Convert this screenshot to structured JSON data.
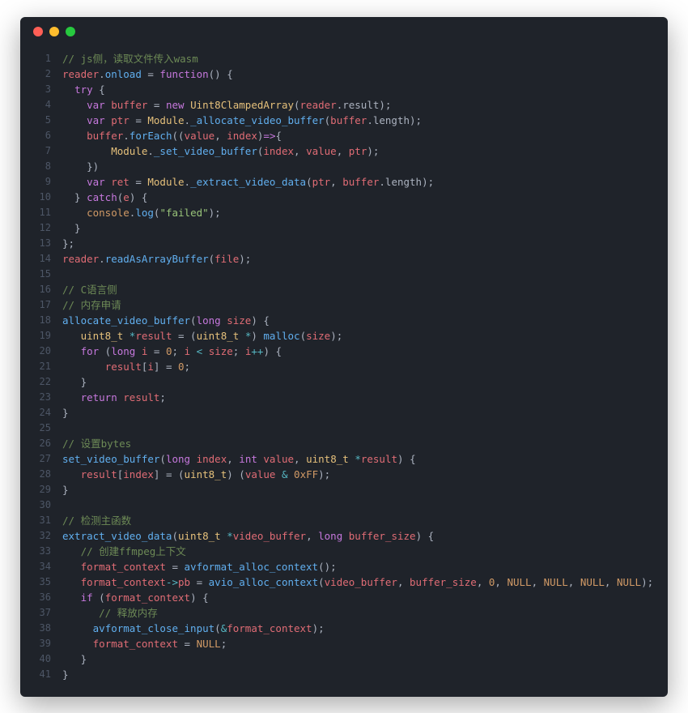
{
  "code_lines": [
    [
      [
        "cm",
        "// "
      ],
      [
        "cm-cn",
        "js侧，读取文件传入wasm"
      ]
    ],
    [
      [
        "id",
        "reader"
      ],
      [
        "punc",
        "."
      ],
      [
        "fn",
        "onload"
      ],
      [
        "punc",
        " = "
      ],
      [
        "kw",
        "function"
      ],
      [
        "punc",
        "() {"
      ]
    ],
    [
      [
        "punc",
        "  "
      ],
      [
        "kw",
        "try"
      ],
      [
        "punc",
        " {"
      ]
    ],
    [
      [
        "punc",
        "    "
      ],
      [
        "kw",
        "var"
      ],
      [
        "punc",
        " "
      ],
      [
        "id",
        "buffer"
      ],
      [
        "punc",
        " = "
      ],
      [
        "kw",
        "new"
      ],
      [
        "punc",
        " "
      ],
      [
        "type",
        "Uint8ClampedArray"
      ],
      [
        "punc",
        "("
      ],
      [
        "id",
        "reader"
      ],
      [
        "punc",
        "."
      ],
      [
        "prop",
        "result"
      ],
      [
        "punc",
        ");"
      ]
    ],
    [
      [
        "punc",
        "    "
      ],
      [
        "kw",
        "var"
      ],
      [
        "punc",
        " "
      ],
      [
        "id",
        "ptr"
      ],
      [
        "punc",
        " = "
      ],
      [
        "type",
        "Module"
      ],
      [
        "punc",
        "."
      ],
      [
        "fn",
        "_allocate_video_buffer"
      ],
      [
        "punc",
        "("
      ],
      [
        "id",
        "buffer"
      ],
      [
        "punc",
        "."
      ],
      [
        "prop",
        "length"
      ],
      [
        "punc",
        ");"
      ]
    ],
    [
      [
        "punc",
        "    "
      ],
      [
        "id",
        "buffer"
      ],
      [
        "punc",
        "."
      ],
      [
        "fn",
        "forEach"
      ],
      [
        "punc",
        "(("
      ],
      [
        "param",
        "value"
      ],
      [
        "punc",
        ", "
      ],
      [
        "param",
        "index"
      ],
      [
        "punc",
        ")"
      ],
      [
        "kw",
        "=>"
      ],
      [
        "punc",
        "{"
      ]
    ],
    [
      [
        "punc",
        "        "
      ],
      [
        "type",
        "Module"
      ],
      [
        "punc",
        "."
      ],
      [
        "fn",
        "_set_video_buffer"
      ],
      [
        "punc",
        "("
      ],
      [
        "id",
        "index"
      ],
      [
        "punc",
        ", "
      ],
      [
        "id",
        "value"
      ],
      [
        "punc",
        ", "
      ],
      [
        "id",
        "ptr"
      ],
      [
        "punc",
        ");"
      ]
    ],
    [
      [
        "punc",
        "    })"
      ]
    ],
    [
      [
        "punc",
        "    "
      ],
      [
        "kw",
        "var"
      ],
      [
        "punc",
        " "
      ],
      [
        "id",
        "ret"
      ],
      [
        "punc",
        " = "
      ],
      [
        "type",
        "Module"
      ],
      [
        "punc",
        "."
      ],
      [
        "fn",
        "_extract_video_data"
      ],
      [
        "punc",
        "("
      ],
      [
        "id",
        "ptr"
      ],
      [
        "punc",
        ", "
      ],
      [
        "id",
        "buffer"
      ],
      [
        "punc",
        "."
      ],
      [
        "prop",
        "length"
      ],
      [
        "punc",
        ");"
      ]
    ],
    [
      [
        "punc",
        "  } "
      ],
      [
        "kw",
        "catch"
      ],
      [
        "punc",
        "("
      ],
      [
        "id",
        "e"
      ],
      [
        "punc",
        ") {"
      ]
    ],
    [
      [
        "punc",
        "    "
      ],
      [
        "id2",
        "console"
      ],
      [
        "punc",
        "."
      ],
      [
        "fn",
        "log"
      ],
      [
        "punc",
        "("
      ],
      [
        "str",
        "\"failed\""
      ],
      [
        "punc",
        ");"
      ]
    ],
    [
      [
        "punc",
        "  }"
      ]
    ],
    [
      [
        "punc",
        "};"
      ]
    ],
    [
      [
        "id",
        "reader"
      ],
      [
        "punc",
        "."
      ],
      [
        "fn",
        "readAsArrayBuffer"
      ],
      [
        "punc",
        "("
      ],
      [
        "id",
        "file"
      ],
      [
        "punc",
        ");"
      ]
    ],
    [],
    [
      [
        "cm",
        "// "
      ],
      [
        "cm-cn",
        "C语言侧"
      ]
    ],
    [
      [
        "cm",
        "// "
      ],
      [
        "cm-cn",
        "内存申请"
      ]
    ],
    [
      [
        "fn",
        "allocate_video_buffer"
      ],
      [
        "punc",
        "("
      ],
      [
        "kw",
        "long"
      ],
      [
        "punc",
        " "
      ],
      [
        "param",
        "size"
      ],
      [
        "punc",
        ") {"
      ]
    ],
    [
      [
        "punc",
        "   "
      ],
      [
        "type",
        "uint8_t"
      ],
      [
        "punc",
        " "
      ],
      [
        "op",
        "*"
      ],
      [
        "id",
        "result"
      ],
      [
        "punc",
        " = ("
      ],
      [
        "type",
        "uint8_t"
      ],
      [
        "punc",
        " "
      ],
      [
        "op",
        "*"
      ],
      [
        "punc",
        ") "
      ],
      [
        "fn",
        "malloc"
      ],
      [
        "punc",
        "("
      ],
      [
        "id",
        "size"
      ],
      [
        "punc",
        ");"
      ]
    ],
    [
      [
        "punc",
        "   "
      ],
      [
        "kw",
        "for"
      ],
      [
        "punc",
        " ("
      ],
      [
        "kw",
        "long"
      ],
      [
        "punc",
        " "
      ],
      [
        "id",
        "i"
      ],
      [
        "punc",
        " = "
      ],
      [
        "num",
        "0"
      ],
      [
        "punc",
        "; "
      ],
      [
        "id",
        "i"
      ],
      [
        "punc",
        " "
      ],
      [
        "op",
        "<"
      ],
      [
        "punc",
        " "
      ],
      [
        "id",
        "size"
      ],
      [
        "punc",
        "; "
      ],
      [
        "id",
        "i"
      ],
      [
        "op",
        "++"
      ],
      [
        "punc",
        ") {"
      ]
    ],
    [
      [
        "punc",
        "       "
      ],
      [
        "id",
        "result"
      ],
      [
        "punc",
        "["
      ],
      [
        "id",
        "i"
      ],
      [
        "punc",
        "] = "
      ],
      [
        "num",
        "0"
      ],
      [
        "punc",
        ";"
      ]
    ],
    [
      [
        "punc",
        "   }"
      ]
    ],
    [
      [
        "punc",
        "   "
      ],
      [
        "kw",
        "return"
      ],
      [
        "punc",
        " "
      ],
      [
        "id",
        "result"
      ],
      [
        "punc",
        ";"
      ]
    ],
    [
      [
        "punc",
        "}"
      ]
    ],
    [],
    [
      [
        "cm",
        "// "
      ],
      [
        "cm-cn",
        "设置bytes"
      ]
    ],
    [
      [
        "fn",
        "set_video_buffer"
      ],
      [
        "punc",
        "("
      ],
      [
        "kw",
        "long"
      ],
      [
        "punc",
        " "
      ],
      [
        "param",
        "index"
      ],
      [
        "punc",
        ", "
      ],
      [
        "kw",
        "int"
      ],
      [
        "punc",
        " "
      ],
      [
        "param",
        "value"
      ],
      [
        "punc",
        ", "
      ],
      [
        "type",
        "uint8_t"
      ],
      [
        "punc",
        " "
      ],
      [
        "op",
        "*"
      ],
      [
        "param",
        "result"
      ],
      [
        "punc",
        ") {"
      ]
    ],
    [
      [
        "punc",
        "   "
      ],
      [
        "id",
        "result"
      ],
      [
        "punc",
        "["
      ],
      [
        "id",
        "index"
      ],
      [
        "punc",
        "] = ("
      ],
      [
        "type",
        "uint8_t"
      ],
      [
        "punc",
        ") ("
      ],
      [
        "id",
        "value"
      ],
      [
        "punc",
        " "
      ],
      [
        "op",
        "&"
      ],
      [
        "punc",
        " "
      ],
      [
        "num",
        "0xFF"
      ],
      [
        "punc",
        ");"
      ]
    ],
    [
      [
        "punc",
        "}"
      ]
    ],
    [],
    [
      [
        "cm",
        "// "
      ],
      [
        "cm-cn",
        "检测主函数"
      ]
    ],
    [
      [
        "fn",
        "extract_video_data"
      ],
      [
        "punc",
        "("
      ],
      [
        "type",
        "uint8_t"
      ],
      [
        "punc",
        " "
      ],
      [
        "op",
        "*"
      ],
      [
        "param",
        "video_buffer"
      ],
      [
        "punc",
        ", "
      ],
      [
        "kw",
        "long"
      ],
      [
        "punc",
        " "
      ],
      [
        "param",
        "buffer_size"
      ],
      [
        "punc",
        ") {"
      ]
    ],
    [
      [
        "punc",
        "   "
      ],
      [
        "cm",
        "// "
      ],
      [
        "cm-cn",
        "创建ffmpeg上下文"
      ]
    ],
    [
      [
        "punc",
        "   "
      ],
      [
        "id",
        "format_context"
      ],
      [
        "punc",
        " = "
      ],
      [
        "fn",
        "avformat_alloc_context"
      ],
      [
        "punc",
        "();"
      ]
    ],
    [
      [
        "punc",
        "   "
      ],
      [
        "id",
        "format_context"
      ],
      [
        "op",
        "->"
      ],
      [
        "id",
        "pb"
      ],
      [
        "punc",
        " = "
      ],
      [
        "fn",
        "avio_alloc_context"
      ],
      [
        "punc",
        "("
      ],
      [
        "id",
        "video_buffer"
      ],
      [
        "punc",
        ", "
      ],
      [
        "id",
        "buffer_size"
      ],
      [
        "punc",
        ", "
      ],
      [
        "num",
        "0"
      ],
      [
        "punc",
        ", "
      ],
      [
        "kwnull",
        "NULL"
      ],
      [
        "punc",
        ", "
      ],
      [
        "kwnull",
        "NULL"
      ],
      [
        "punc",
        ", "
      ],
      [
        "kwnull",
        "NULL"
      ],
      [
        "punc",
        ", "
      ],
      [
        "kwnull",
        "NULL"
      ],
      [
        "punc",
        ");"
      ]
    ],
    [
      [
        "punc",
        "   "
      ],
      [
        "kw",
        "if"
      ],
      [
        "punc",
        " ("
      ],
      [
        "id",
        "format_context"
      ],
      [
        "punc",
        ") {"
      ]
    ],
    [
      [
        "punc",
        "      "
      ],
      [
        "cm",
        "// "
      ],
      [
        "cm-cn",
        "释放内存"
      ]
    ],
    [
      [
        "punc",
        "     "
      ],
      [
        "fn",
        "avformat_close_input"
      ],
      [
        "punc",
        "("
      ],
      [
        "op",
        "&"
      ],
      [
        "id",
        "format_context"
      ],
      [
        "punc",
        ");"
      ]
    ],
    [
      [
        "punc",
        "     "
      ],
      [
        "id",
        "format_context"
      ],
      [
        "punc",
        " = "
      ],
      [
        "kwnull",
        "NULL"
      ],
      [
        "punc",
        ";"
      ]
    ],
    [
      [
        "punc",
        "   }"
      ]
    ],
    [
      [
        "punc",
        "}"
      ]
    ]
  ]
}
